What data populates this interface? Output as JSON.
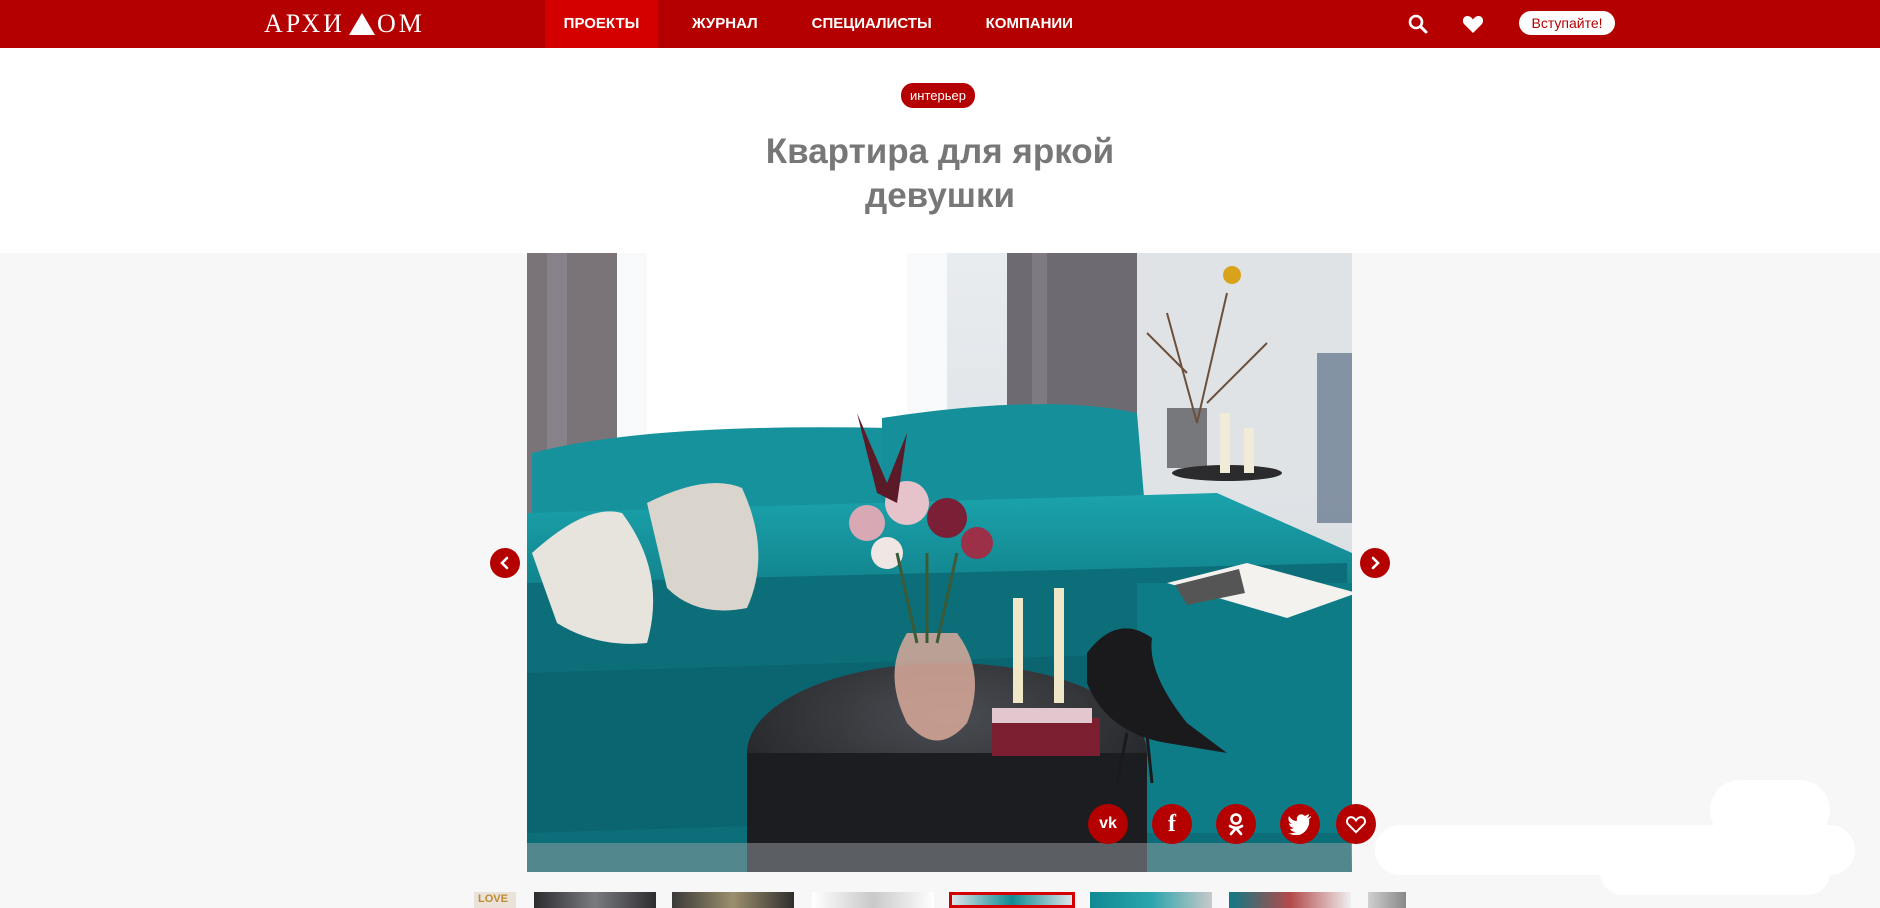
{
  "header": {
    "logo_text_left": "АРХИ",
    "logo_text_right": "ОМ",
    "nav": [
      {
        "label": "ПРОЕКТЫ",
        "active": true
      },
      {
        "label": "ЖУРНАЛ",
        "active": false
      },
      {
        "label": "СПЕЦИАЛИСТЫ",
        "active": false
      },
      {
        "label": "КОМПАНИИ",
        "active": false
      }
    ],
    "join_label": "Вступайте!",
    "icons": [
      "search-icon",
      "heart-icon"
    ]
  },
  "article": {
    "tag": "интерьер",
    "title_line1": "Квартира для яркой",
    "title_line2": "девушки"
  },
  "gallery": {
    "prev_icon": "chevron-left-icon",
    "next_icon": "chevron-right-icon",
    "share": [
      {
        "icon": "vk-icon",
        "label": "vk"
      },
      {
        "icon": "facebook-icon",
        "label": "f"
      },
      {
        "icon": "odnoklassniki-icon"
      },
      {
        "icon": "twitter-icon"
      },
      {
        "icon": "heart-outline-icon"
      }
    ],
    "thumbnail_text": "LOVE",
    "thumbnail_count": 9,
    "active_thumbnail": 5
  },
  "colors": {
    "brand_red": "#b50000",
    "active_nav": "#d40000",
    "title_gray": "#777777",
    "gallery_bg": "#f7f7f7",
    "sofa_teal": "#0f8a93"
  }
}
